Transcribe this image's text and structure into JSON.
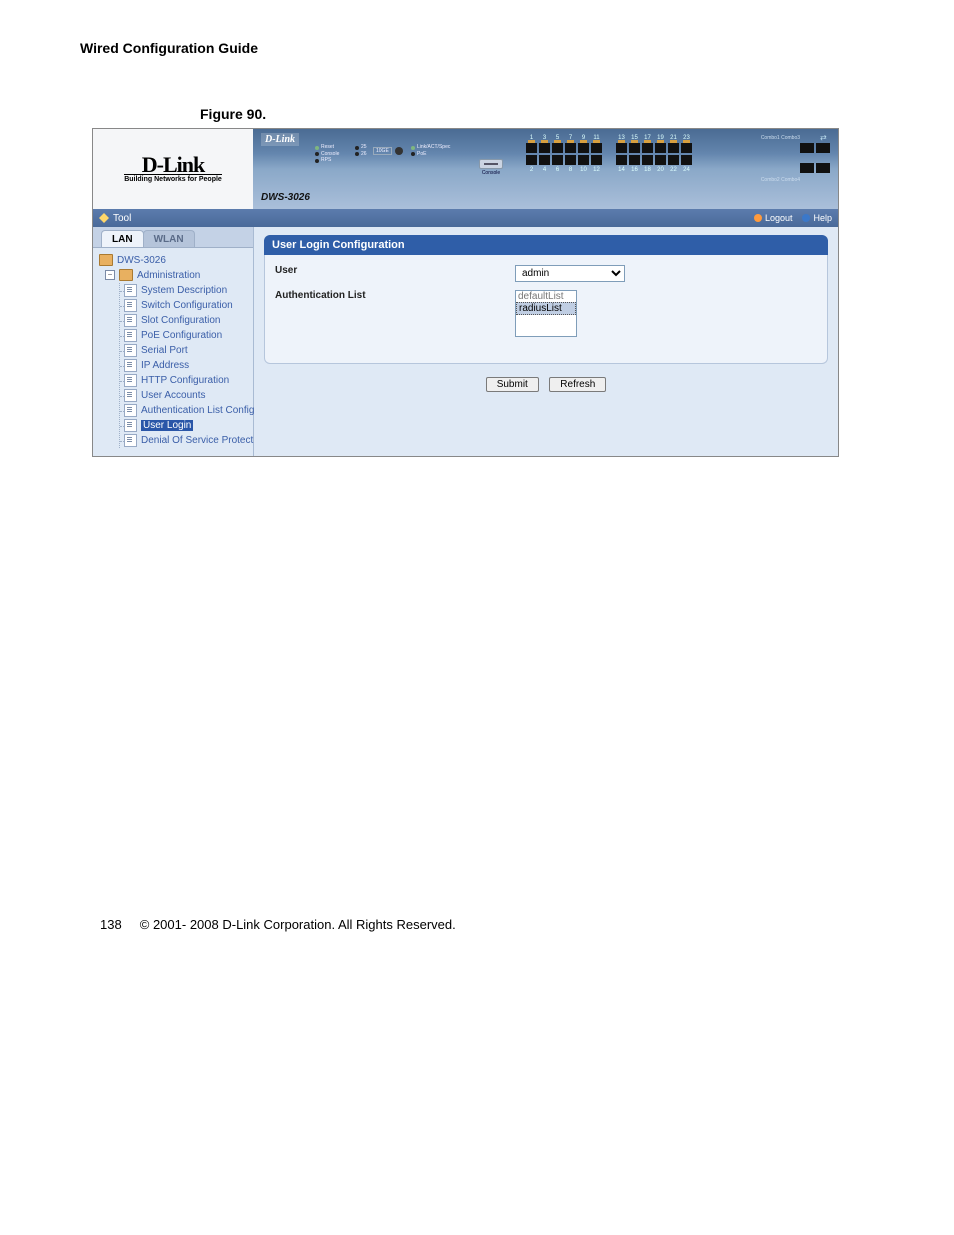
{
  "doc": {
    "header": "Wired Configuration Guide",
    "figure_label": "Figure 90.",
    "page_number": "138",
    "copyright": "© 2001- 2008 D-Link Corporation. All Rights Reserved."
  },
  "brand": {
    "logo_text": "D-Link",
    "tagline": "Building Networks for People",
    "inner_brand": "D-Link",
    "model": "DWS-3026"
  },
  "device_panel": {
    "leds": {
      "reset": "Reset",
      "console": "Console",
      "rps": "RPS",
      "p25": "25",
      "p26": "26",
      "ten_ge": "10GE",
      "link": "Link/ACT/Spec",
      "poe": "PoE"
    },
    "console_label": "Console",
    "ports_top": [
      "1",
      "3",
      "5",
      "7",
      "9",
      "11",
      "13",
      "15",
      "17",
      "19",
      "21",
      "23"
    ],
    "ports_bottom": [
      "2",
      "4",
      "6",
      "8",
      "10",
      "12",
      "14",
      "16",
      "18",
      "20",
      "22",
      "24"
    ],
    "combo_top": "Combo1 Combo3",
    "combo_bottom": "Combo2 Combo4"
  },
  "toolbar": {
    "tool_label": "Tool",
    "logout": "Logout",
    "help": "Help"
  },
  "tabs": {
    "lan": "LAN",
    "wlan": "WLAN"
  },
  "tree": {
    "root": "DWS-3026",
    "folder": "Administration",
    "items": [
      "System Description",
      "Switch Configuration",
      "Slot Configuration",
      "PoE Configuration",
      "Serial Port",
      "IP Address",
      "HTTP Configuration",
      "User Accounts",
      "Authentication List Config",
      "User Login",
      "Denial Of Service Protect"
    ],
    "selected_index": 9
  },
  "panel": {
    "title": "User Login Configuration",
    "user_label": "User",
    "user_value": "admin",
    "authlist_label": "Authentication List",
    "authlist_options": [
      "defaultList",
      "radiusList"
    ],
    "authlist_selected": "radiusList",
    "submit": "Submit",
    "refresh": "Refresh"
  }
}
